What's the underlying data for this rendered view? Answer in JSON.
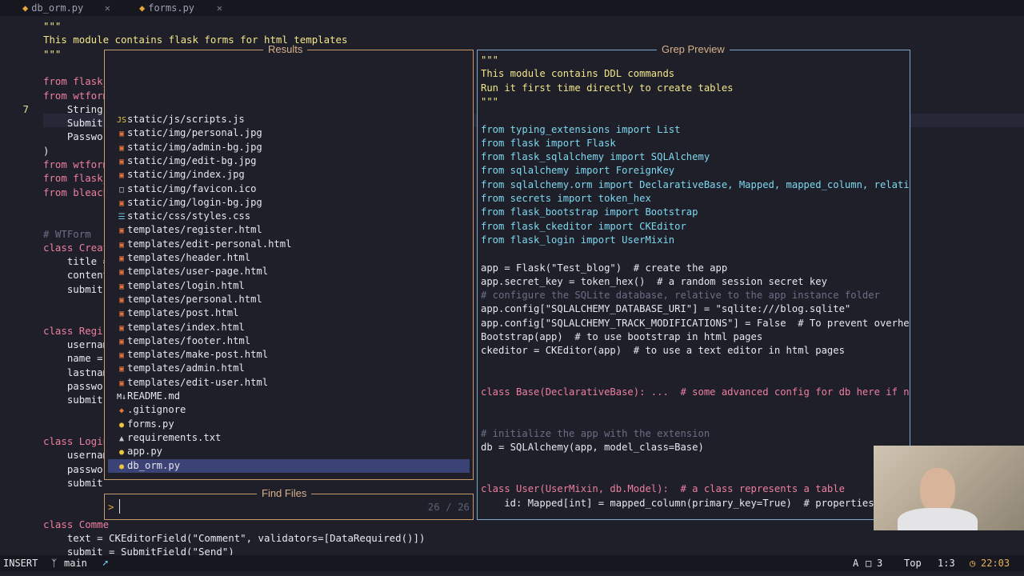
{
  "tabs": [
    {
      "label": "db_orm.py",
      "icon": "python-file-icon"
    },
    {
      "label": "forms.py",
      "icon": "python-file-icon"
    }
  ],
  "editor": {
    "lines": [
      {
        "num": "",
        "text": "\"\"\""
      },
      {
        "num": "",
        "text": "This module contains flask forms for html templates"
      },
      {
        "num": "",
        "text": "\"\"\""
      },
      {
        "num": "",
        "text": ""
      },
      {
        "num": "",
        "text": "from flask_"
      },
      {
        "num": "",
        "text": "from wtform"
      },
      {
        "num": "7",
        "text": "    StringF"
      },
      {
        "num": "",
        "text": "    SubmitF"
      },
      {
        "num": "",
        "text": "    Passwor"
      },
      {
        "num": "",
        "text": ")"
      },
      {
        "num": "",
        "text": "from wtform"
      },
      {
        "num": "",
        "text": "from flask_"
      },
      {
        "num": "",
        "text": "from bleach"
      },
      {
        "num": "",
        "text": ""
      },
      {
        "num": "",
        "text": ""
      },
      {
        "num": "",
        "text": "# WTForm"
      },
      {
        "num": "",
        "text": "class Creat"
      },
      {
        "num": "",
        "text": "    title ="
      },
      {
        "num": "",
        "text": "    content"
      },
      {
        "num": "",
        "text": "    submit"
      },
      {
        "num": "",
        "text": ""
      },
      {
        "num": "",
        "text": ""
      },
      {
        "num": "",
        "text": "class Regis"
      },
      {
        "num": "",
        "text": "    usernam"
      },
      {
        "num": "",
        "text": "    name ="
      },
      {
        "num": "",
        "text": "    lastnam"
      },
      {
        "num": "",
        "text": "    passwor"
      },
      {
        "num": "",
        "text": "    submit"
      },
      {
        "num": "",
        "text": ""
      },
      {
        "num": "",
        "text": ""
      },
      {
        "num": "",
        "text": "class Login"
      },
      {
        "num": "",
        "text": "    usernam"
      },
      {
        "num": "",
        "text": "    passwor"
      },
      {
        "num": "",
        "text": "    submit"
      },
      {
        "num": "",
        "text": ""
      },
      {
        "num": "",
        "text": ""
      },
      {
        "num": "",
        "text": "class Comme"
      },
      {
        "num": "",
        "text": "    text = CKEditorField(\"Comment\", validators=[DataRequired()])"
      },
      {
        "num": "",
        "text": "    submit = SubmitField(\"Send\")"
      }
    ]
  },
  "results": {
    "title": "Results",
    "items": [
      {
        "icon": "js-icon",
        "label": "static/js/scripts.js"
      },
      {
        "icon": "image-icon",
        "label": "static/img/personal.jpg"
      },
      {
        "icon": "image-icon",
        "label": "static/img/admin-bg.jpg"
      },
      {
        "icon": "image-icon",
        "label": "static/img/edit-bg.jpg"
      },
      {
        "icon": "image-icon",
        "label": "static/img/index.jpg"
      },
      {
        "icon": "file-icon",
        "label": "static/img/favicon.ico"
      },
      {
        "icon": "image-icon",
        "label": "static/img/login-bg.jpg"
      },
      {
        "icon": "css-icon",
        "label": "static/css/styles.css"
      },
      {
        "icon": "html-icon",
        "label": "templates/register.html"
      },
      {
        "icon": "html-icon",
        "label": "templates/edit-personal.html"
      },
      {
        "icon": "html-icon",
        "label": "templates/header.html"
      },
      {
        "icon": "html-icon",
        "label": "templates/user-page.html"
      },
      {
        "icon": "html-icon",
        "label": "templates/login.html"
      },
      {
        "icon": "html-icon",
        "label": "templates/personal.html"
      },
      {
        "icon": "html-icon",
        "label": "templates/post.html"
      },
      {
        "icon": "html-icon",
        "label": "templates/index.html"
      },
      {
        "icon": "html-icon",
        "label": "templates/footer.html"
      },
      {
        "icon": "html-icon",
        "label": "templates/make-post.html"
      },
      {
        "icon": "html-icon",
        "label": "templates/admin.html"
      },
      {
        "icon": "html-icon",
        "label": "templates/edit-user.html"
      },
      {
        "icon": "markdown-icon",
        "label": "README.md"
      },
      {
        "icon": "git-icon",
        "label": ".gitignore"
      },
      {
        "icon": "python-file-icon",
        "label": "forms.py"
      },
      {
        "icon": "text-file-icon",
        "label": "requirements.txt"
      },
      {
        "icon": "python-file-icon",
        "label": "app.py"
      },
      {
        "icon": "python-file-icon",
        "label": "db_orm.py",
        "selected": true
      }
    ]
  },
  "find": {
    "title": "Find Files",
    "prompt": ">",
    "query": "",
    "count": "26 / 26"
  },
  "preview": {
    "title": "Grep Preview",
    "lines": [
      "\"\"\"",
      "This module contains DDL commands",
      "Run it first time directly to create tables",
      "\"\"\"",
      "",
      "from typing_extensions import List",
      "from flask import Flask",
      "from flask_sqlalchemy import SQLAlchemy",
      "from sqlalchemy import ForeignKey",
      "from sqlalchemy.orm import DeclarativeBase, Mapped, mapped_column, relationship",
      "from secrets import token_hex",
      "from flask_bootstrap import Bootstrap",
      "from flask_ckeditor import CKEditor",
      "from flask_login import UserMixin",
      "",
      "app = Flask(\"Test_blog\")  # create the app",
      "app.secret_key = token_hex()  # a random session secret key",
      "# configure the SQLite database, relative to the app instance folder",
      "app.config[\"SQLALCHEMY_DATABASE_URI\"] = \"sqlite:///blog.sqlite\"",
      "app.config[\"SQLALCHEMY_TRACK_MODIFICATIONS\"] = False  # To prevent overhead",
      "Bootstrap(app)  # to use bootstrap in html pages",
      "ckeditor = CKEditor(app)  # to use a text editor in html pages",
      "",
      "",
      "class Base(DeclarativeBase): ...  # some advanced config for db here if needed",
      "",
      "",
      "# initialize the app with the extension",
      "db = SQLAlchemy(app, model_class=Base)",
      "",
      "",
      "class User(UserMixin, db.Model):  # a class represents a table",
      "    id: Mapped[int] = mapped_column(primary_key=True)  # properties are co"
    ]
  },
  "statusbar": {
    "mode": "INSERT",
    "branch": "main",
    "lsp": "A",
    "diagnostics": "3",
    "scroll": "Top",
    "position": "1:3",
    "clock": "22:03",
    "colors": {
      "mode_bg": "#1e1f29",
      "accent": "#e9b35a"
    }
  }
}
